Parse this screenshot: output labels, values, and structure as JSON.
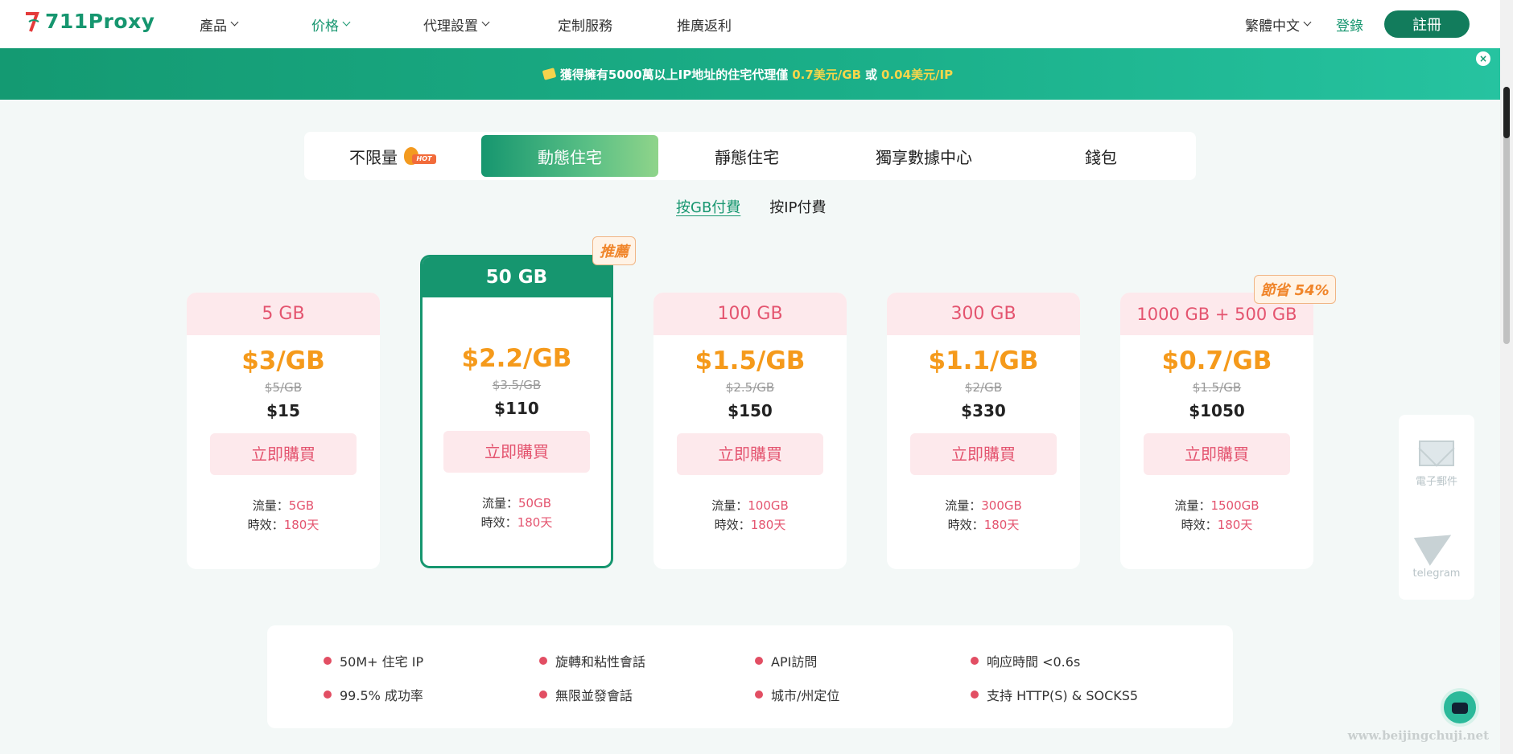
{
  "header": {
    "logo_text": "711Proxy",
    "nav": [
      {
        "label": "產品",
        "has_caret": true
      },
      {
        "label": "价格",
        "has_caret": true,
        "active": true
      },
      {
        "label": "代理設置",
        "has_caret": true
      },
      {
        "label": "定制服務",
        "has_caret": false
      },
      {
        "label": "推廣返利",
        "has_caret": false
      }
    ],
    "language": "繁體中文",
    "login": "登錄",
    "register": "註冊"
  },
  "banner": {
    "text_before": "獲得擁有5000萬以上IP地址的住宅代理僅",
    "price_gb": "0.7美元/GB",
    "or": "或",
    "price_ip": "0.04美元/IP",
    "close": "×"
  },
  "tabs": [
    {
      "label": "不限量",
      "hot": true
    },
    {
      "label": "動態住宅",
      "active": true
    },
    {
      "label": "靜態住宅"
    },
    {
      "label": "獨享數據中心"
    },
    {
      "label": "錢包"
    }
  ],
  "hot_tag": "HOT",
  "subtabs": [
    {
      "label": "按GB付費",
      "active": true
    },
    {
      "label": "按IP付費"
    }
  ],
  "plans": [
    {
      "name": "5 GB",
      "price": "$3/GB",
      "old_price": "$5/GB",
      "total": "$15",
      "buy": "立即購買",
      "traffic_label": "流量：",
      "traffic": "5GB",
      "validity_label": "時效：",
      "validity": "180天"
    },
    {
      "name": "50 GB",
      "price": "$2.2/GB",
      "old_price": "$3.5/GB",
      "total": "$110",
      "buy": "立即購買",
      "traffic_label": "流量：",
      "traffic": "50GB",
      "validity_label": "時效：",
      "validity": "180天",
      "featured": true
    },
    {
      "name": "100 GB",
      "price": "$1.5/GB",
      "old_price": "$2.5/GB",
      "total": "$150",
      "buy": "立即購買",
      "traffic_label": "流量：",
      "traffic": "100GB",
      "validity_label": "時效：",
      "validity": "180天"
    },
    {
      "name": "300 GB",
      "price": "$1.1/GB",
      "old_price": "$2/GB",
      "total": "$330",
      "buy": "立即購買",
      "traffic_label": "流量：",
      "traffic": "300GB",
      "validity_label": "時效：",
      "validity": "180天"
    },
    {
      "name": "1000 GB + 500 GB",
      "price": "$0.7/GB",
      "old_price": "$1.5/GB",
      "total": "$1050",
      "buy": "立即購買",
      "traffic_label": "流量：",
      "traffic": "1500GB",
      "validity_label": "時效：",
      "validity": "180天"
    }
  ],
  "badges": {
    "recommend": "推薦",
    "save": "節省 54%"
  },
  "features": [
    "50M+ 住宅 IP",
    "旋轉和粘性會話",
    "API訪問",
    "响应時間 <0.6s",
    "99.5% 成功率",
    "無限並發會話",
    "城市/州定位",
    "支持 HTTP(S) & SOCKS5"
  ],
  "side": {
    "email": "電子郵件",
    "telegram": "telegram"
  },
  "watermark": "www.beijingchuji.net",
  "colors": {
    "brand": "#16966f",
    "accent_pink": "#e4546f",
    "price_orange": "#f59a1b"
  }
}
